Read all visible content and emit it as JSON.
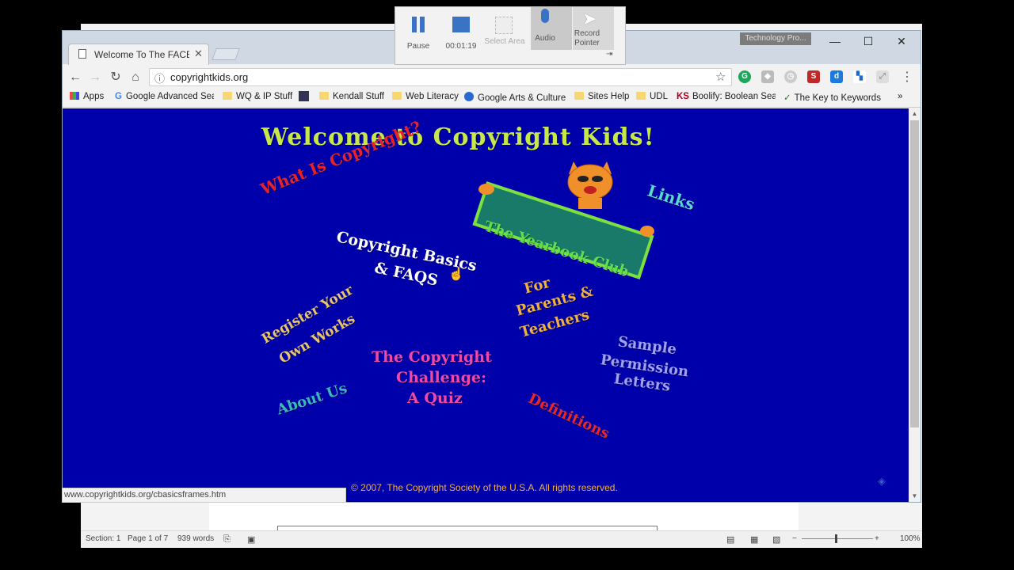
{
  "recorder": {
    "pause_label": "Pause",
    "timer": "00:01:19",
    "select_area_label": "Select Area",
    "audio_label": "Audio",
    "record_pointer_label": "Record Pointer"
  },
  "window": {
    "tech_label": "Technology Pro..."
  },
  "tab": {
    "title": "Welcome To The FACE Ki"
  },
  "address_bar": {
    "url": "copyrightkids.org"
  },
  "bookmarks": [
    {
      "label": "Apps"
    },
    {
      "label": "Google Advanced Sea"
    },
    {
      "label": "WQ & IP Stuff"
    },
    {
      "label": "Kendall Stuff"
    },
    {
      "label": "Web Literacy"
    },
    {
      "label": "Google Arts & Culture"
    },
    {
      "label": "Sites Help"
    },
    {
      "label": "UDL"
    },
    {
      "label": "Boolify: Boolean Searc"
    },
    {
      "label": "The Key to Keywords"
    }
  ],
  "site": {
    "title": "Welcome to Copyright Kids!",
    "what_is": "What Is Copyright?",
    "basics_line1": "Copyright Basics",
    "basics_line2": "& FAQS",
    "links": "Links",
    "sign": "The Yearbook Club",
    "register_line1": "Register Your",
    "register_line2": "Own Works",
    "parents_line1": "For",
    "parents_line2": "Parents &",
    "parents_line3": "Teachers",
    "quiz_line1": "The Copyright",
    "quiz_line2": "Challenge:",
    "quiz_line3": "A Quiz",
    "sample_line1": "Sample",
    "sample_line2": "Permission",
    "sample_line3": "Letters",
    "about": "About Us",
    "definitions": "Definitions",
    "footer": "© 2007, The Copyright Society of the U.S.A.  All rights reserved."
  },
  "status_url": "www.copyrightkids.org/cbasicsframes.htm",
  "word_status": {
    "section": "Section: 1",
    "page": "Page 1 of 7",
    "words": "939 words",
    "zoom": "100%"
  }
}
